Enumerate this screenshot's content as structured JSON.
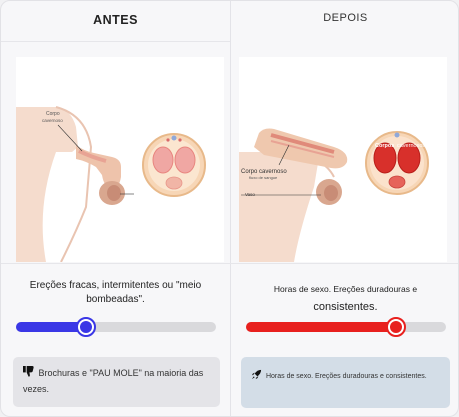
{
  "before": {
    "heading": "ANTES",
    "image_labels": {
      "corpo": "Corpo",
      "cavernoso": "cavernoso"
    },
    "description": "Ereções fracas, intermitentes ou \"meio bombeadas\".",
    "slider_value": 35,
    "color": "#3a37e6",
    "note_icon": "thumbs-down-icon",
    "note_text": "Brochuras e \"PAU MOLE\" na maioria das vezes."
  },
  "after": {
    "heading": "DEPOIS",
    "image_labels": {
      "corpo_cavernoso": "Corpo cavernoso",
      "fluxo": "fluxo de sangue",
      "corpos": "Corpos",
      "cavernosos": "cavernosos",
      "vaso": "Vaso"
    },
    "description_small": "Horas de sexo. Ereções duradouras e",
    "description_big": "consistentes.",
    "slider_value": 75,
    "color": "#e8201e",
    "note_icon": "rocket-icon",
    "note_text": "Horas de sexo. Ereções duradouras e consistentes."
  }
}
